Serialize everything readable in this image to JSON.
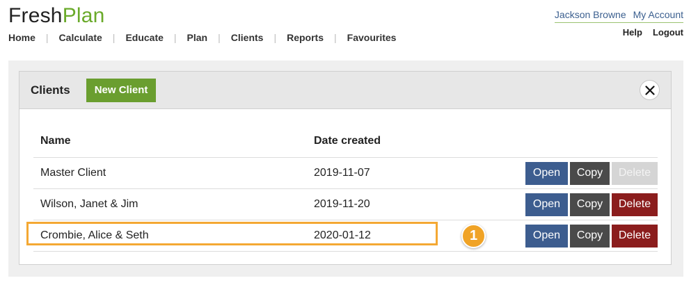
{
  "app": {
    "logo_part1": "Fresh",
    "logo_part2": "Plan",
    "brand_color": "#6aaa2a"
  },
  "nav": {
    "items": [
      {
        "label": "Home"
      },
      {
        "label": "Calculate"
      },
      {
        "label": "Educate"
      },
      {
        "label": "Plan"
      },
      {
        "label": "Clients"
      },
      {
        "label": "Reports"
      },
      {
        "label": "Favourites"
      }
    ]
  },
  "user": {
    "name": "Jackson Browne",
    "account_label": "My Account",
    "help_label": "Help",
    "logout_label": "Logout"
  },
  "panel": {
    "title": "Clients",
    "new_client_label": "New Client",
    "close_icon": "close-icon",
    "columns": {
      "name": "Name",
      "date": "Date created"
    },
    "rows": [
      {
        "name": "Master Client",
        "date": "2019-11-07",
        "open": "Open",
        "copy": "Copy",
        "delete": "Delete",
        "delete_disabled": true
      },
      {
        "name": "Wilson, Janet & Jim",
        "date": "2019-11-20",
        "open": "Open",
        "copy": "Copy",
        "delete": "Delete",
        "delete_disabled": false
      },
      {
        "name": "Crombie, Alice & Seth",
        "date": "2020-01-12",
        "open": "Open",
        "copy": "Copy",
        "delete": "Delete",
        "delete_disabled": false
      }
    ]
  },
  "annotation": {
    "marker_label": "1",
    "color": "#f4a833"
  }
}
